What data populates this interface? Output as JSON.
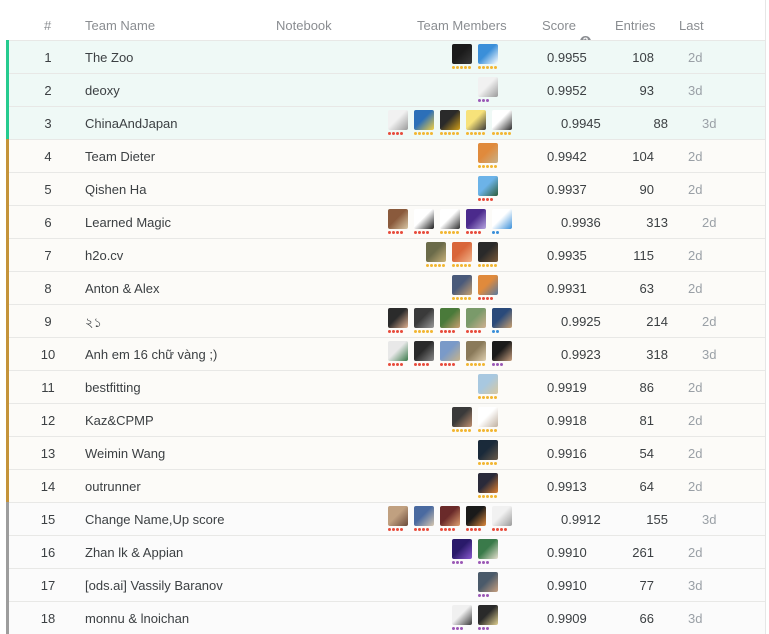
{
  "header": {
    "rank": "#",
    "team_name": "Team Name",
    "notebook": "Notebook",
    "team_members": "Team Members",
    "score": "Score",
    "entries": "Entries",
    "last": "Last"
  },
  "rows": [
    {
      "rank": "1",
      "team": "The Zoo",
      "score": "0.9955",
      "entries": "108",
      "last": "2d",
      "tier": "gold",
      "members": [
        {
          "colors": [
            "#1b1b1b",
            "#3a3a3a"
          ],
          "dot": "#f2b632",
          "n": 5
        },
        {
          "colors": [
            "#3a8fd9",
            "#ffffff"
          ],
          "dot": "#f2b632",
          "n": 5
        }
      ]
    },
    {
      "rank": "2",
      "team": "deoxy",
      "score": "0.9952",
      "entries": "93",
      "last": "3d",
      "tier": "gold",
      "members": [
        {
          "colors": [
            "#f1f1f1",
            "#9a9a9a"
          ],
          "dot": "#9b59b6",
          "n": 3
        }
      ]
    },
    {
      "rank": "3",
      "team": "ChinaAndJapan",
      "score": "0.9945",
      "entries": "88",
      "last": "3d",
      "tier": "gold",
      "members": [
        {
          "colors": [
            "#f1f1f1",
            "#9a9a9a"
          ],
          "dot": "#e74c3c",
          "n": 4
        },
        {
          "colors": [
            "#2c6fb8",
            "#f4d03f"
          ],
          "dot": "#f2b632",
          "n": 5
        },
        {
          "colors": [
            "#2a2a2a",
            "#d4a017"
          ],
          "dot": "#f2b632",
          "n": 5
        },
        {
          "colors": [
            "#f7e27a",
            "#3a3a3a"
          ],
          "dot": "#f2b632",
          "n": 5
        },
        {
          "colors": [
            "#ffffff",
            "#2b2b2b"
          ],
          "dot": "#f2b632",
          "n": 5
        }
      ]
    },
    {
      "rank": "4",
      "team": "Team Dieter",
      "score": "0.9942",
      "entries": "104",
      "last": "2d",
      "tier": "bronze",
      "members": [
        {
          "colors": [
            "#e08a3c",
            "#c8b28a"
          ],
          "dot": "#f2b632",
          "n": 5
        }
      ]
    },
    {
      "rank": "5",
      "team": "Qishen Ha",
      "score": "0.9937",
      "entries": "90",
      "last": "2d",
      "tier": "bronze",
      "members": [
        {
          "colors": [
            "#6cb3e8",
            "#2e5d3a"
          ],
          "dot": "#e74c3c",
          "n": 4
        }
      ]
    },
    {
      "rank": "6",
      "team": "Learned Magic",
      "score": "0.9936",
      "entries": "313",
      "last": "2d",
      "tier": "bronze",
      "members": [
        {
          "colors": [
            "#8a5a3c",
            "#d9c7a5"
          ],
          "dot": "#e74c3c",
          "n": 4
        },
        {
          "colors": [
            "#ffffff",
            "#1a1a1a"
          ],
          "dot": "#e74c3c",
          "n": 4
        },
        {
          "colors": [
            "#ffffff",
            "#2d2d2d"
          ],
          "dot": "#f2b632",
          "n": 5
        },
        {
          "colors": [
            "#4b2a8c",
            "#b7a6e0"
          ],
          "dot": "#e74c3c",
          "n": 4
        },
        {
          "colors": [
            "#ffffff",
            "#3a8fd9"
          ],
          "dot": "#3a8fd9",
          "n": 2
        }
      ]
    },
    {
      "rank": "7",
      "team": "h2o.cv",
      "score": "0.9935",
      "entries": "115",
      "last": "2d",
      "tier": "bronze",
      "members": [
        {
          "colors": [
            "#6b6b4a",
            "#c9b27a"
          ],
          "dot": "#f2b632",
          "n": 5
        },
        {
          "colors": [
            "#d9663a",
            "#f0b48a"
          ],
          "dot": "#f2b632",
          "n": 5
        },
        {
          "colors": [
            "#2a2a2a",
            "#7a5a3a"
          ],
          "dot": "#f2b632",
          "n": 5
        }
      ]
    },
    {
      "rank": "8",
      "team": "Anton & Alex",
      "score": "0.9931",
      "entries": "63",
      "last": "2d",
      "tier": "bronze",
      "members": [
        {
          "colors": [
            "#4a5a7a",
            "#c8a070"
          ],
          "dot": "#f2b632",
          "n": 5
        },
        {
          "colors": [
            "#e08a3c",
            "#5a7aa0"
          ],
          "dot": "#e74c3c",
          "n": 4
        }
      ]
    },
    {
      "rank": "9",
      "team": "২১",
      "score": "0.9925",
      "entries": "214",
      "last": "2d",
      "tier": "bronze",
      "members": [
        {
          "colors": [
            "#2b2b2b",
            "#e0b090"
          ],
          "dot": "#e74c3c",
          "n": 4
        },
        {
          "colors": [
            "#3a3a3a",
            "#9a9a9a"
          ],
          "dot": "#f2b632",
          "n": 5
        },
        {
          "colors": [
            "#4a7a3a",
            "#c9a070"
          ],
          "dot": "#e74c3c",
          "n": 4
        },
        {
          "colors": [
            "#7a9a6a",
            "#d0b090"
          ],
          "dot": "#e74c3c",
          "n": 4
        },
        {
          "colors": [
            "#2a4a7a",
            "#c8a070"
          ],
          "dot": "#3a8fd9",
          "n": 2
        }
      ]
    },
    {
      "rank": "10",
      "team": "Anh em 16 chữ vàng ;)",
      "score": "0.9923",
      "entries": "318",
      "last": "3d",
      "tier": "bronze",
      "members": [
        {
          "colors": [
            "#e8e8e8",
            "#3a7a4a"
          ],
          "dot": "#e74c3c",
          "n": 4
        },
        {
          "colors": [
            "#2a2a2a",
            "#8a8a8a"
          ],
          "dot": "#e74c3c",
          "n": 4
        },
        {
          "colors": [
            "#7a9ac8",
            "#c8b48a"
          ],
          "dot": "#e74c3c",
          "n": 4
        },
        {
          "colors": [
            "#8a7a5a",
            "#e0d0b0"
          ],
          "dot": "#f2b632",
          "n": 5
        },
        {
          "colors": [
            "#1a1a1a",
            "#c8a080"
          ],
          "dot": "#9b59b6",
          "n": 3
        }
      ]
    },
    {
      "rank": "11",
      "team": "bestfitting",
      "score": "0.9919",
      "entries": "86",
      "last": "2d",
      "tier": "bronze",
      "members": [
        {
          "colors": [
            "#a8c8e0",
            "#d8c8a0"
          ],
          "dot": "#f2b632",
          "n": 5
        }
      ]
    },
    {
      "rank": "12",
      "team": "Kaz&CPMP",
      "score": "0.9918",
      "entries": "81",
      "last": "2d",
      "tier": "bronze",
      "members": [
        {
          "colors": [
            "#3a3a3a",
            "#c09070"
          ],
          "dot": "#f2b632",
          "n": 5
        },
        {
          "colors": [
            "#ffffff",
            "#c0b0a0"
          ],
          "dot": "#f2b632",
          "n": 5
        }
      ]
    },
    {
      "rank": "13",
      "team": "Weimin Wang",
      "score": "0.9916",
      "entries": "54",
      "last": "2d",
      "tier": "bronze",
      "members": [
        {
          "colors": [
            "#1a2a3a",
            "#6a5a4a"
          ],
          "dot": "#f2b632",
          "n": 5
        }
      ]
    },
    {
      "rank": "14",
      "team": "outrunner",
      "score": "0.9913",
      "entries": "64",
      "last": "2d",
      "tier": "bronze",
      "members": [
        {
          "colors": [
            "#2a2a3a",
            "#e08030"
          ],
          "dot": "#f2b632",
          "n": 5
        }
      ]
    },
    {
      "rank": "15",
      "team": "Change Name,Up score",
      "score": "0.9912",
      "entries": "155",
      "last": "3d",
      "tier": "plain",
      "members": [
        {
          "colors": [
            "#c0a080",
            "#6a4a3a"
          ],
          "dot": "#e74c3c",
          "n": 4
        },
        {
          "colors": [
            "#4a6aa0",
            "#d8c8b0"
          ],
          "dot": "#e74c3c",
          "n": 4
        },
        {
          "colors": [
            "#6a2a2a",
            "#e0a070"
          ],
          "dot": "#e74c3c",
          "n": 4
        },
        {
          "colors": [
            "#1a1a1a",
            "#e08a3c"
          ],
          "dot": "#e74c3c",
          "n": 4
        },
        {
          "colors": [
            "#f1f1f1",
            "#9a9a9a"
          ],
          "dot": "#e74c3c",
          "n": 4
        }
      ]
    },
    {
      "rank": "16",
      "team": "Zhan lk & Appian",
      "score": "0.9910",
      "entries": "261",
      "last": "2d",
      "tier": "plain",
      "members": [
        {
          "colors": [
            "#2a1a6a",
            "#8a5ad0"
          ],
          "dot": "#9b59b6",
          "n": 3
        },
        {
          "colors": [
            "#3a7a4a",
            "#e8e0d0"
          ],
          "dot": "#9b59b6",
          "n": 3
        }
      ]
    },
    {
      "rank": "17",
      "team": "[ods.ai] Vassily Baranov",
      "score": "0.9910",
      "entries": "77",
      "last": "3d",
      "tier": "plain",
      "members": [
        {
          "colors": [
            "#4a5a6a",
            "#c8a080"
          ],
          "dot": "#9b59b6",
          "n": 3
        }
      ]
    },
    {
      "rank": "18",
      "team": "monnu & lnoichan",
      "score": "0.9909",
      "entries": "66",
      "last": "3d",
      "tier": "plain",
      "members": [
        {
          "colors": [
            "#f0f0f0",
            "#3a3a3a"
          ],
          "dot": "#9b59b6",
          "n": 3
        },
        {
          "colors": [
            "#2a2a2a",
            "#e0d090"
          ],
          "dot": "#9b59b6",
          "n": 3
        }
      ]
    }
  ]
}
